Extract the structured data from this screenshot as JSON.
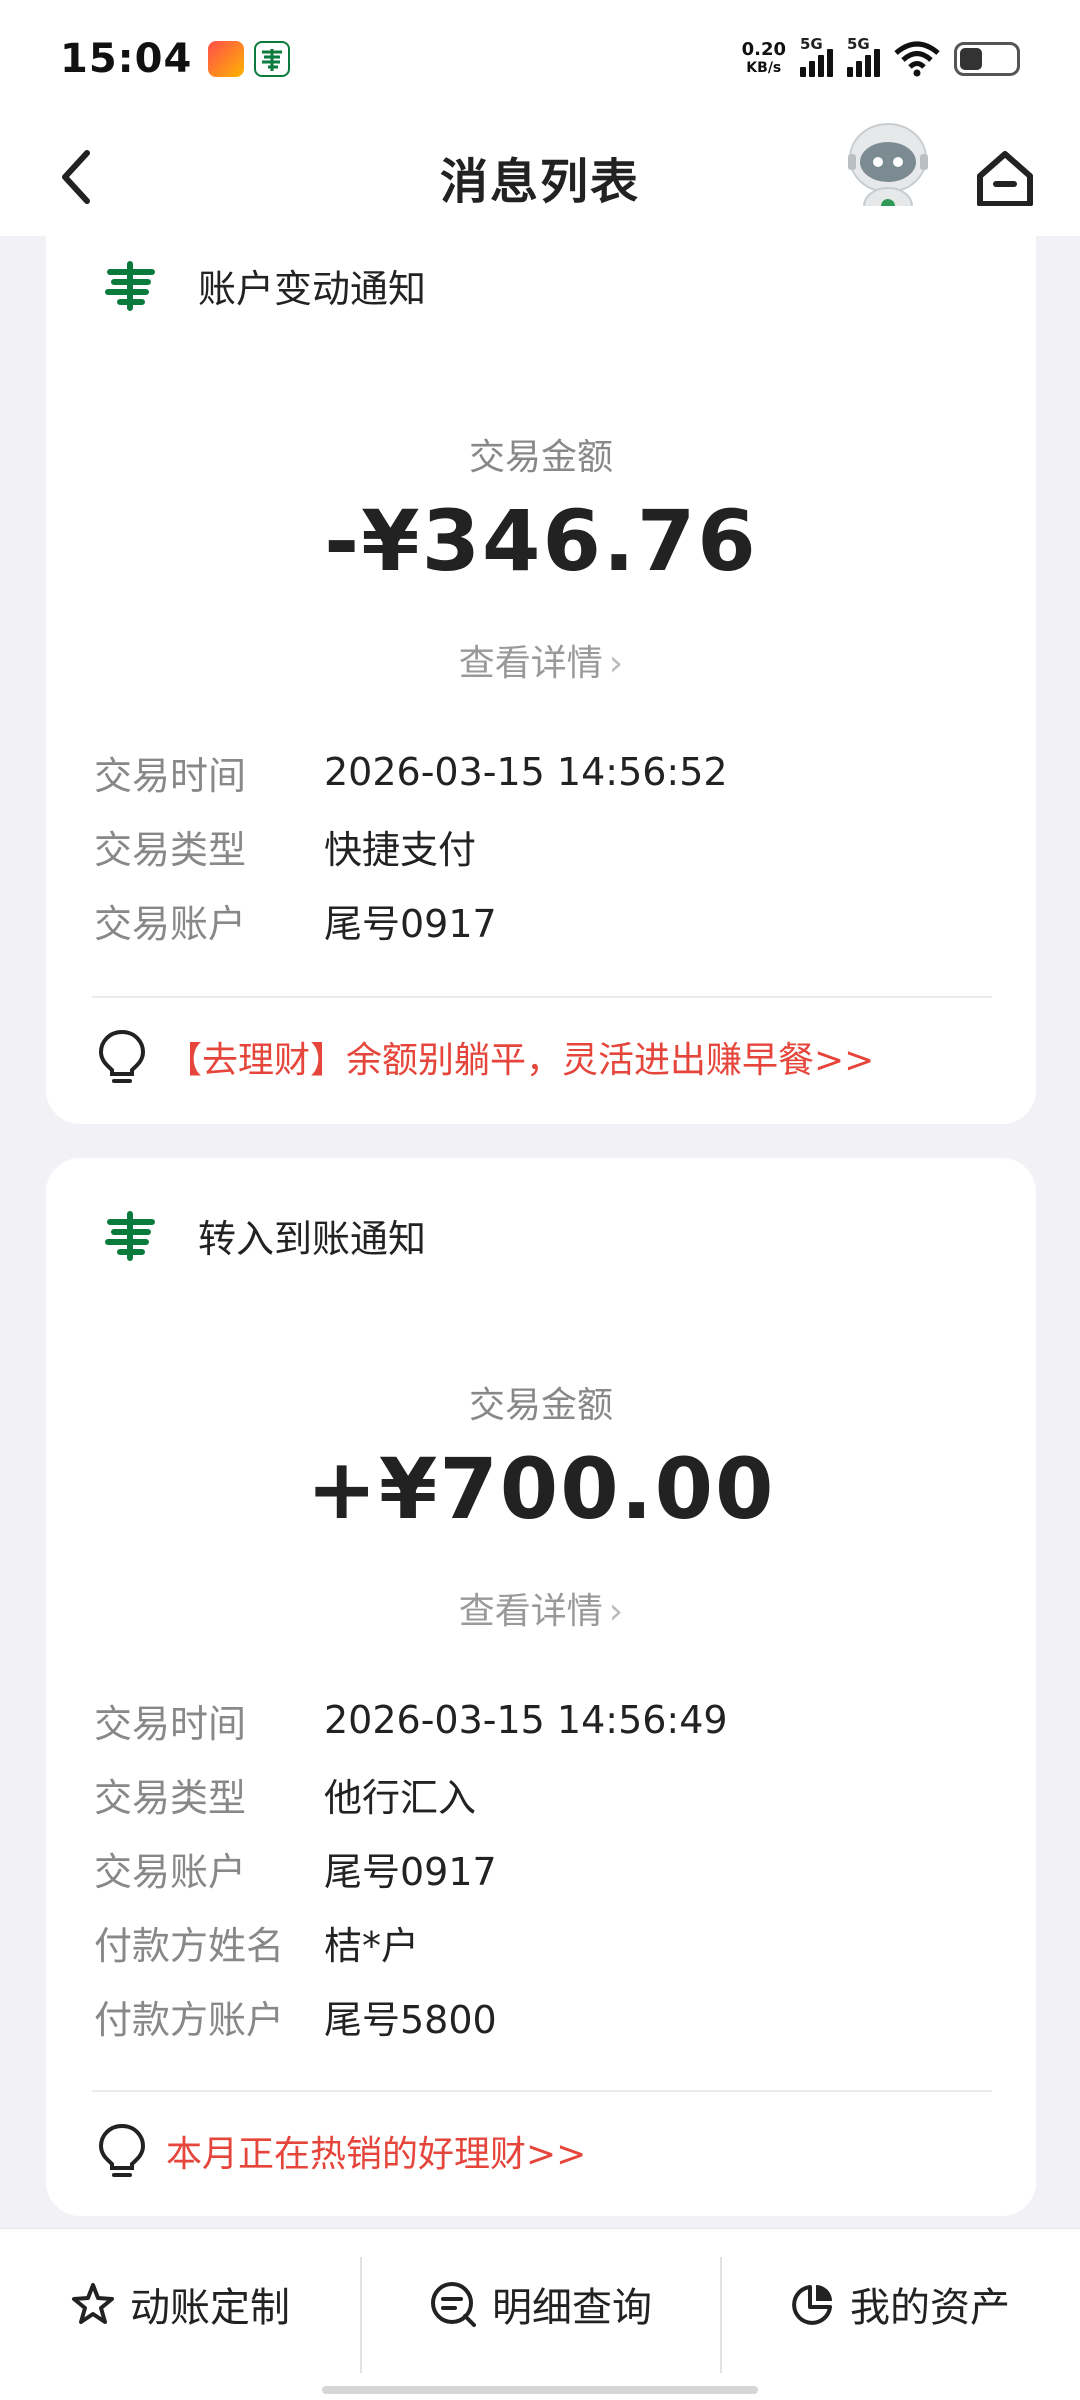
{
  "status_bar": {
    "time": "15:04",
    "net_speed_value": "0.20",
    "net_speed_unit": "KB/s",
    "signal1_label": "5G",
    "signal2_label": "5G",
    "icons": [
      "app-icon-1",
      "postal-bank-app-icon",
      "signal-icon",
      "signal-icon",
      "wifi-icon",
      "battery-icon"
    ]
  },
  "header": {
    "title": "消息列表",
    "back_icon": "chevron-left-icon",
    "assistant_icon": "robot-assistant-icon",
    "home_icon": "home-icon"
  },
  "messages": [
    {
      "title": "账户变动通知",
      "amount_label": "交易金额",
      "amount": "-¥346.76",
      "detail_link": "查看详情",
      "rows": [
        {
          "k": "交易时间",
          "v": "2026-03-15 14:56:52"
        },
        {
          "k": "交易类型",
          "v": "快捷支付"
        },
        {
          "k": "交易账户",
          "v": "尾号0917"
        }
      ],
      "promo": "【去理财】余额别躺平，灵活进出赚早餐>>"
    },
    {
      "title": "转入到账通知",
      "amount_label": "交易金额",
      "amount": "+¥700.00",
      "detail_link": "查看详情",
      "rows": [
        {
          "k": "交易时间",
          "v": "2026-03-15 14:56:49"
        },
        {
          "k": "交易类型",
          "v": "他行汇入"
        },
        {
          "k": "交易账户",
          "v": "尾号0917"
        },
        {
          "k": "付款方姓名",
          "v": "桔*户"
        },
        {
          "k": "付款方账户",
          "v": "尾号5800"
        }
      ],
      "promo": "本月正在热销的好理财>>"
    }
  ],
  "bottom_tabs": [
    {
      "label": "动账定制",
      "icon": "star-settings-icon"
    },
    {
      "label": "明细查询",
      "icon": "search-list-icon"
    },
    {
      "label": "我的资产",
      "icon": "pie-chart-icon"
    }
  ],
  "colors": {
    "brand_green": "#0a7a3d",
    "promo_red": "#e5453b",
    "background": "#f2f2f6"
  }
}
